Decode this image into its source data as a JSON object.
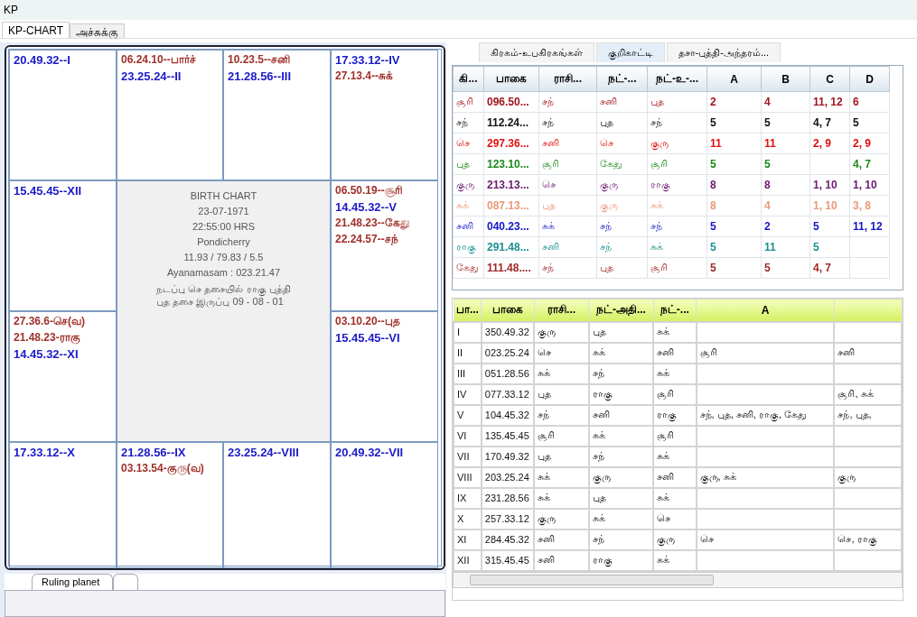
{
  "window": {
    "title": "KP"
  },
  "tabs": [
    {
      "label": "KP-CHART",
      "selected": true
    },
    {
      "label": "அச்சுக்கு",
      "selected": false
    }
  ],
  "chart": {
    "cells": [
      {
        "kind": "house",
        "entries": [
          {
            "text": "20.49.32--I",
            "kind": "house"
          }
        ]
      },
      {
        "kind": "house",
        "entries": [
          {
            "text": "06.24.10--பார்ச்",
            "kind": "planet"
          },
          {
            "text": "23.25.24--II",
            "kind": "house"
          }
        ]
      },
      {
        "kind": "house",
        "entries": [
          {
            "text": "10.23.5--சனி",
            "kind": "planet"
          },
          {
            "text": "21.28.56--III",
            "kind": "house"
          }
        ]
      },
      {
        "kind": "house",
        "entries": [
          {
            "text": "17.33.12--IV",
            "kind": "house"
          },
          {
            "text": "27.13.4--சுக்",
            "kind": "planet"
          }
        ]
      },
      {
        "kind": "house",
        "entries": [
          {
            "text": "15.45.45--XII",
            "kind": "house"
          }
        ]
      },
      {
        "kind": "center",
        "lines": [
          "BIRTH CHART",
          "23-07-1971",
          "22:55:00  HRS",
          "Pondicherry",
          "11.93 / 79.83 / 5.5",
          "Ayanamasam : 023.21.47"
        ],
        "dasa": [
          "நடப்பு  செ தசையில் ராகு புத்தி",
          "புத தசை இருப்பு 09 - 08 - 01"
        ]
      },
      {
        "kind": "house",
        "entries": [
          {
            "text": "06.50.19--சூரி",
            "kind": "planet"
          },
          {
            "text": "14.45.32--V",
            "kind": "house"
          },
          {
            "text": "21.48.23--கேது",
            "kind": "planet"
          },
          {
            "text": "22.24.57--சந்",
            "kind": "planet"
          }
        ]
      },
      {
        "kind": "house",
        "entries": [
          {
            "text": "27.36.6-செ(வ)",
            "kind": "planet"
          },
          {
            "text": "21.48.23-ராகு",
            "kind": "planet"
          },
          {
            "text": "14.45.32--XI",
            "kind": "house"
          }
        ]
      },
      {
        "kind": "house",
        "entries": [
          {
            "text": "03.10.20--புத",
            "kind": "planet"
          },
          {
            "text": "15.45.45--VI",
            "kind": "house"
          }
        ]
      },
      {
        "kind": "house",
        "entries": [
          {
            "text": "17.33.12--X",
            "kind": "house"
          }
        ]
      },
      {
        "kind": "house",
        "entries": [
          {
            "text": "21.28.56--IX",
            "kind": "house"
          },
          {
            "text": "03.13.54-குரு(வ)",
            "kind": "planet"
          }
        ]
      },
      {
        "kind": "house",
        "entries": [
          {
            "text": "23.25.24--VIII",
            "kind": "house"
          }
        ]
      },
      {
        "kind": "house",
        "entries": [
          {
            "text": "20.49.32--VII",
            "kind": "house"
          }
        ]
      }
    ]
  },
  "bottom_tabs": [
    {
      "label": "Ruling planet",
      "selected": true
    },
    {
      "selected": false
    }
  ],
  "right_tabs": [
    {
      "label": "கிரகம்-உபகிரகங்கள்",
      "selected": false
    },
    {
      "label": "குறிகாட்டி",
      "selected": true
    },
    {
      "label": "தசா-புத்தி-அந்தரம்...",
      "selected": false
    }
  ],
  "planet_table": {
    "columns": [
      "கி...",
      "பாகை",
      "ராசி...",
      "நட்-...",
      "நட்-உ-...",
      "A",
      "B",
      "C",
      "D"
    ],
    "rows": [
      {
        "color": "#a0141e",
        "cells": [
          "சூரி",
          "096.50...",
          "சந்",
          "சனி",
          "புத",
          "2",
          "4",
          "11, 12",
          "6"
        ]
      },
      {
        "color": "#111111",
        "cells": [
          "சந்",
          "112.24...",
          "சந்",
          "புத",
          "சந்",
          "5",
          "5",
          "4, 7",
          "5"
        ]
      },
      {
        "color": "#e01010",
        "cells": [
          "செ",
          "297.36...",
          "சனி",
          "செ",
          "குரு",
          "11",
          "11",
          "2, 9",
          "2, 9"
        ]
      },
      {
        "color": "#1a8a1a",
        "cells": [
          "புத",
          "123.10...",
          "சூரி",
          "கேது",
          "சூரி",
          "5",
          "5",
          null,
          "4, 7"
        ]
      },
      {
        "color": "#6a1a70",
        "cells": [
          "குரு",
          "213.13...",
          "செ",
          "குரு",
          "ராகு",
          "8",
          "8",
          "1, 10",
          "1, 10"
        ]
      },
      {
        "color": "#e89a7a",
        "cells": [
          "சுக்",
          "087.13...",
          "புத",
          "குரு",
          "சுக்",
          "8",
          "4",
          "1, 10",
          "3, 8"
        ]
      },
      {
        "color": "#1414c8",
        "cells": [
          "சனி",
          "040.23...",
          "சுக்",
          "சந்",
          "சந்",
          "5",
          "2",
          "5",
          "11, 12"
        ]
      },
      {
        "color": "#1a9090",
        "cells": [
          "ராகு",
          "291.48...",
          "சனி",
          "சந்",
          "சுக்",
          "5",
          "11",
          "5",
          null
        ]
      },
      {
        "color": "#a02828",
        "cells": [
          "கேது",
          "111.48....",
          "சந்",
          "புத",
          "சூரி",
          "5",
          "5",
          "4, 7",
          null
        ]
      }
    ]
  },
  "house_table": {
    "columns": [
      "பா...",
      "பாகை",
      "ராசி...",
      "நட்-அதி...",
      "நட்-...",
      "A"
    ],
    "rows": [
      [
        "I",
        "350.49.32",
        "குரு",
        "புத",
        "சுக்",
        null,
        null
      ],
      [
        "II",
        "023.25.24",
        "செ",
        "சுக்",
        "சனி",
        "சூரி",
        "சனி"
      ],
      [
        "III",
        "051.28.56",
        "சுக்",
        "சந்",
        "சுக்",
        null,
        null
      ],
      [
        "IV",
        "077.33.12",
        "புத",
        "ராகு",
        "சூரி",
        null,
        "சூரி, சுக்"
      ],
      [
        "V",
        "104.45.32",
        "சந்",
        "சனி",
        "ராகு",
        "சந், புத, சனி, ராகு, கேது",
        "சந், புத,"
      ],
      [
        "VI",
        "135.45.45",
        "சூரி",
        "சுக்",
        "சூரி",
        null,
        null
      ],
      [
        "VII",
        "170.49.32",
        "புத",
        "சந்",
        "சுக்",
        null,
        null
      ],
      [
        "VIII",
        "203.25.24",
        "சுக்",
        "குரு",
        "சனி",
        "குரு, சுக்",
        "குரு"
      ],
      [
        "IX",
        "231.28.56",
        "சுக்",
        "புத",
        "சுக்",
        null,
        null
      ],
      [
        "X",
        "257.33.12",
        "குரு",
        "சுக்",
        "செ",
        null,
        null
      ],
      [
        "XI",
        "284.45.32",
        "சனி",
        "சந்",
        "குரு",
        "செ",
        "செ, ராகு"
      ],
      [
        "XII",
        "315.45.45",
        "சனி",
        "ராகு",
        "சுக்",
        null,
        null
      ]
    ]
  }
}
